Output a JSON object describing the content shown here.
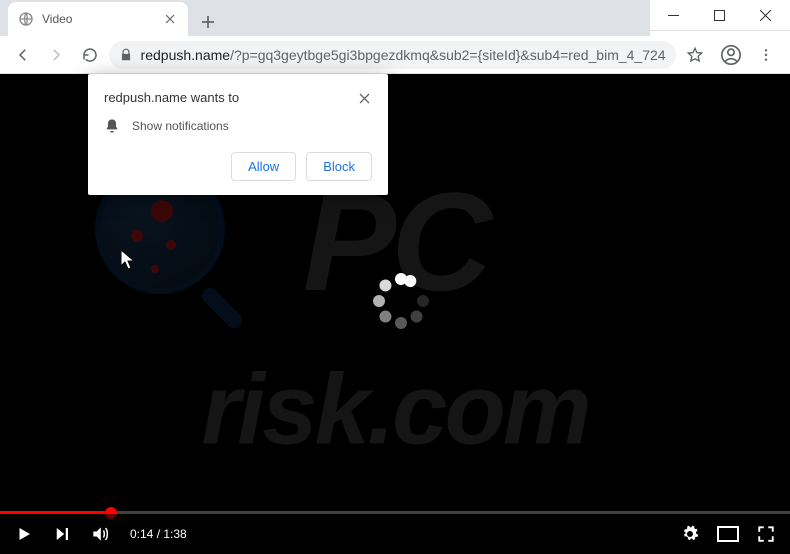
{
  "window": {
    "title": "Video"
  },
  "tab": {
    "title": "Video"
  },
  "address": {
    "domain": "redpush.name",
    "path": "/?p=gq3geytbge5gi3bpgezdkmq&sub2={siteId}&sub4=red_bim_4_724"
  },
  "notification": {
    "title_prefix": "redpush.name",
    "title_suffix": " wants to",
    "permission_label": "Show notifications",
    "allow_label": "Allow",
    "block_label": "Block"
  },
  "video": {
    "current_time": "0:14",
    "duration": "1:38",
    "time_display": "0:14 / 1:38",
    "progress_percent": 14
  },
  "watermark": {
    "line1": "PC",
    "line2": "risk.com"
  },
  "icons": {
    "globe": "globe-icon",
    "lock": "lock-icon",
    "bell": "bell-icon"
  }
}
